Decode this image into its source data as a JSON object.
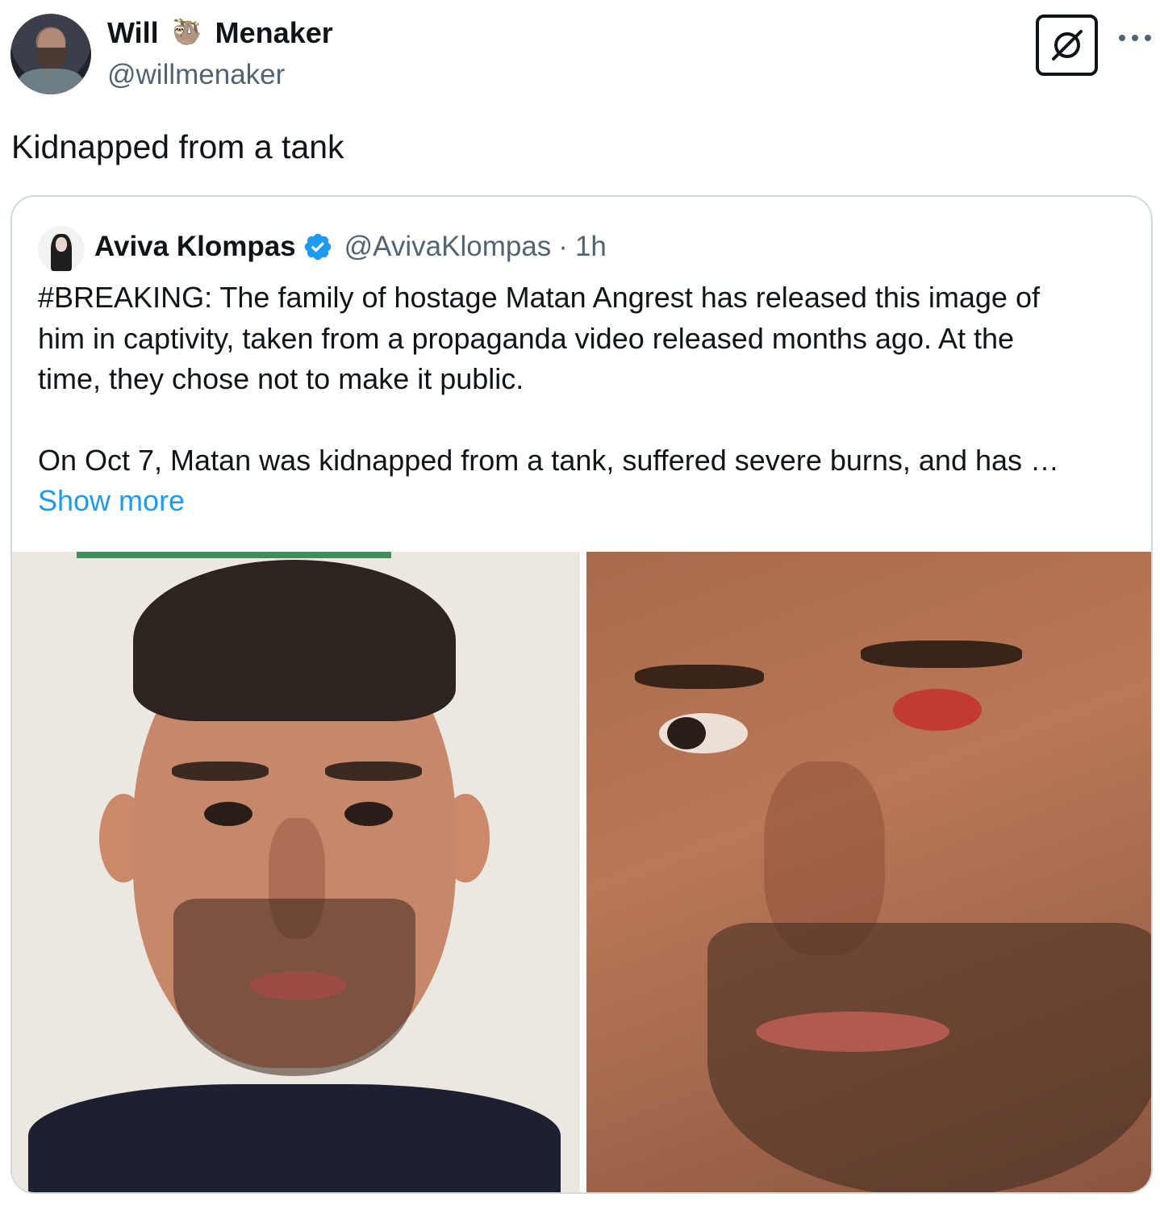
{
  "tweet": {
    "author": {
      "name_first": "Will",
      "name_emoji": "🦥",
      "name_last": "Menaker",
      "handle": "@willmenaker"
    },
    "icons": {
      "grok": "grok-icon",
      "more": "more-options-icon"
    },
    "text": "Kidnapped from a tank",
    "quoted": {
      "name": "Aviva Klompas",
      "handle": "@AvivaKlompas",
      "separator": "·",
      "time": "1h",
      "text_lines": [
        "#BREAKING: The family of hostage Matan Angrest has released this image of",
        "him in captivity, taken from a propaganda video released months ago. At the",
        "time, they chose not to make it public.",
        "On Oct 7, Matan was kidnapped from a tank, suffered severe burns, and has …"
      ],
      "show_more": "Show more",
      "colors": {
        "link": "#1d9bf0",
        "verified": "#1d9bf0",
        "muted": "#536471"
      }
    }
  }
}
